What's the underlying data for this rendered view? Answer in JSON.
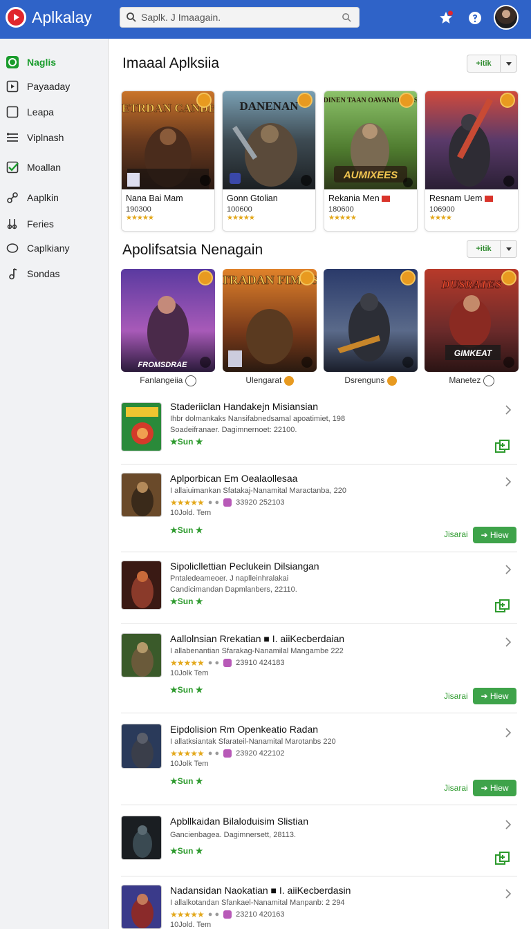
{
  "header": {
    "app_title": "Aplkalay",
    "search_value": "Saplk. J Imaagain.",
    "notification_count": ""
  },
  "sidebar": {
    "items": [
      {
        "label": "Naglis",
        "icon": "circle-icon",
        "active": true
      },
      {
        "label": "Payaaday",
        "icon": "square-play-icon",
        "active": false
      },
      {
        "label": "Leapa",
        "icon": "square-icon",
        "active": false
      },
      {
        "label": "Viplnash",
        "icon": "list-icon",
        "active": false
      },
      {
        "label": "Moallan",
        "icon": "check-box-icon",
        "active": false
      },
      {
        "label": "Aaplkin",
        "icon": "link-icon",
        "active": false
      },
      {
        "label": "Feries",
        "icon": "tools-icon",
        "active": false
      },
      {
        "label": "Caplkiany",
        "icon": "oval-icon",
        "active": false
      },
      {
        "label": "Sondas",
        "icon": "music-icon",
        "active": false
      }
    ]
  },
  "section1": {
    "title": "Imaaal Aplksiia",
    "button_label": "+itik",
    "cards": [
      {
        "art_title": "DETRDAN CANDES",
        "name": "Nana Bai Mam",
        "num": "190300",
        "stars": "★★★★★"
      },
      {
        "art_title": "DANENAN",
        "name": "Gonn Gtolian",
        "num": "100600",
        "stars": "★★★★★"
      },
      {
        "art_title": "DINEN TAAN OAVANIOTAGS",
        "art_bottom": "AUMIXEES",
        "name": "Rekania Men",
        "num": "180600",
        "stars": "★★★★★"
      },
      {
        "art_title": "",
        "name": "Resnam Uem",
        "num": "106900",
        "stars": "★★★★"
      }
    ]
  },
  "section2": {
    "title": "Apolifsatsia Nenagain",
    "button_label": "+itik",
    "tiles": [
      {
        "art_text": "FROMSDRAE",
        "label": "Fanlangeiia"
      },
      {
        "art_text": "TRADAN FIMOS",
        "label": "Ulengarat"
      },
      {
        "art_text": "",
        "label": "Dsrenguns"
      },
      {
        "art_text": "DUSRATES",
        "art_text2": "GIMKEAT",
        "label": "Manetez"
      }
    ]
  },
  "list": [
    {
      "title": "Staderiiclan Handakejn Misiansian",
      "desc": "Ihbr dolmankaks Nansifabnedsamal apoatimiet, 198",
      "desc2": "Soadeifranaer. Dagimnernoet: 22100.",
      "tag": "Sun",
      "action": "install"
    },
    {
      "title": "Aplporbican Em Oealaollesaa",
      "desc": "I allaiuimankan Sfatakaj-Nanamital Maractanba, 220",
      "rating_text": "33920  252103",
      "size": "10Jold. Tem",
      "tag": "Sun",
      "action": "view",
      "get_label": "Jisarai",
      "view_label": "Hiew"
    },
    {
      "title": "Sipolicllettian Peclukein Dilsiangan",
      "desc": "Pntaledeameoer. J naplleinhralakai",
      "desc2": "Candicimandan Dapmlanbers, 22110.",
      "tag": "Sun",
      "action": "install"
    },
    {
      "title": "Aallolnsian Rrekatian ■ I. aiiKecberdaian",
      "desc": "I allabenantian Sfarakag-Nanamilal Mangambe 222",
      "rating_text": "23910  424183",
      "size": "10Jolk Tem",
      "tag": "Sun",
      "action": "view",
      "get_label": "Jisarai",
      "view_label": "Hiew"
    },
    {
      "title": "Eipdolision Rm Openkeatio Radan",
      "desc": "I allatksiantak Sfarateil-Nanamital Marotanbs 220",
      "rating_text": "23920  422102",
      "size": "10Jolk Tem",
      "tag": "Sun",
      "action": "view",
      "get_label": "Jisarai",
      "view_label": "Hiew"
    },
    {
      "title": "Apbllkaidan Bilaloduisim Slistian",
      "desc": "Gancienbagea. Dagimnersett, 28113.",
      "tag": "Sun",
      "action": "install"
    },
    {
      "title": "Nadansidan Naokatian ■ I. aiiKecberdasin",
      "desc": "I allalkotandan Sfankael-Nanamital Manpanb: 2 294",
      "rating_text": "23210  420163",
      "size": "10Jold. Tem",
      "tag": "",
      "action": "none"
    }
  ],
  "colors": {
    "header_bg": "#2f63c8",
    "accent_green": "#3ea34a",
    "star": "#e3a81c",
    "logo_red": "#e0262d"
  }
}
